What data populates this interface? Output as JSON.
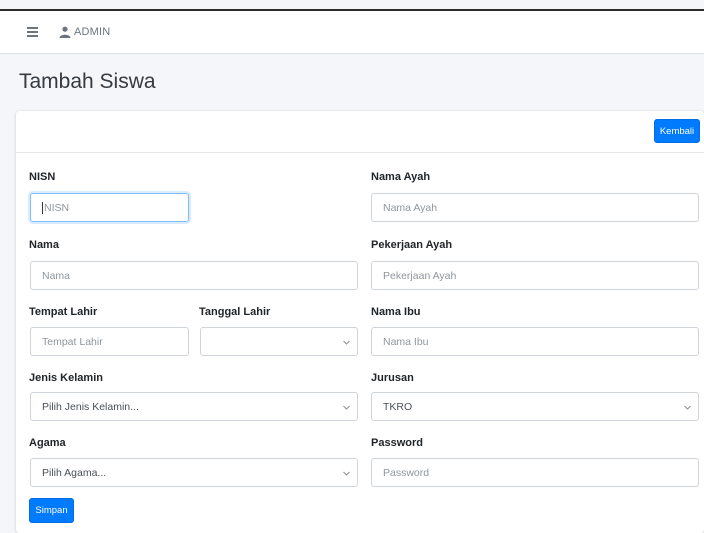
{
  "navbar": {
    "menu_icon": "hamburger-icon",
    "user_icon": "user-icon",
    "user_label": "ADMIN"
  },
  "page": {
    "title": "Tambah Siswa"
  },
  "card": {
    "back_label": "Kembali"
  },
  "form": {
    "nisn": {
      "label": "NISN",
      "placeholder": "NISN"
    },
    "nama": {
      "label": "Nama",
      "placeholder": "Nama"
    },
    "tempat_lahir": {
      "label": "Tempat Lahir",
      "placeholder": "Tempat Lahir"
    },
    "tanggal_lahir": {
      "label": "Tanggal Lahir",
      "value": ""
    },
    "jenis_kelamin": {
      "label": "Jenis Kelamin",
      "value": "Pilih Jenis Kelamin..."
    },
    "agama": {
      "label": "Agama",
      "value": "Pilih Agama..."
    },
    "nama_ayah": {
      "label": "Nama Ayah",
      "placeholder": "Nama Ayah"
    },
    "pekerjaan_ayah": {
      "label": "Pekerjaan Ayah",
      "placeholder": "Pekerjaan Ayah"
    },
    "nama_ibu": {
      "label": "Nama Ibu",
      "placeholder": "Nama Ibu"
    },
    "jurusan": {
      "label": "Jurusan",
      "value": "TKRO"
    },
    "password": {
      "label": "Password",
      "placeholder": "Password"
    },
    "submit_label": "Simpan"
  },
  "colors": {
    "primary": "#007bff",
    "background": "#f4f6f9",
    "card": "#ffffff"
  }
}
